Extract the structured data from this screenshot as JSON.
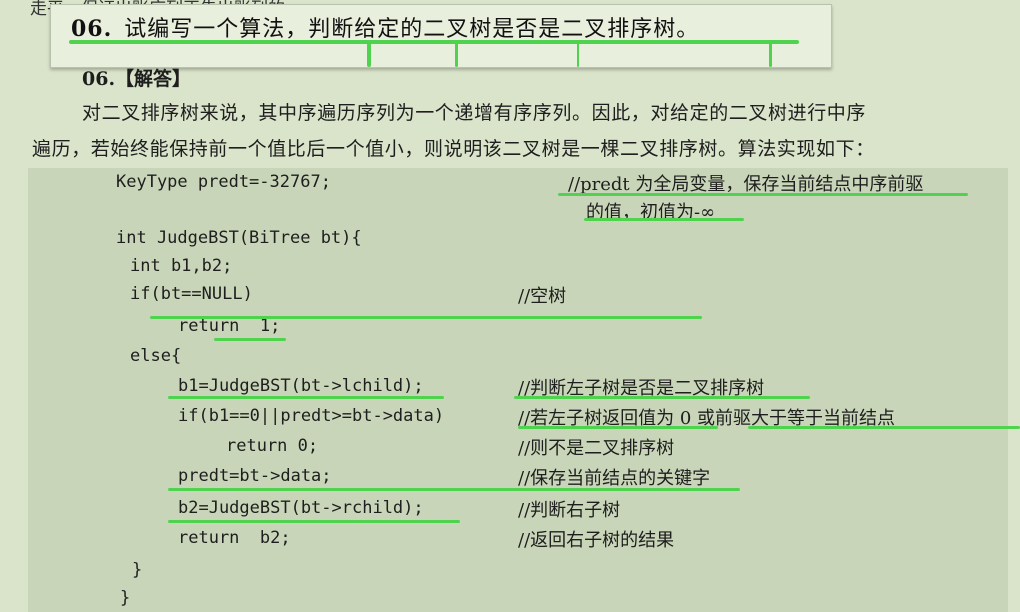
{
  "stray_text": "走平，保证出账序列正告出账列的",
  "question": {
    "number": "06.",
    "text": "试编写一个算法，判断给定的二叉树是否是二叉排序树。"
  },
  "answer": {
    "heading": "06.【解答】",
    "line1": "对二叉排序树来说，其中序遍历序列为一个递增有序序列。因此，对给定的二叉树进行中序",
    "line2": "遍历，若始终能保持前一个值比后一个值小，则说明该二叉树是一棵二叉排序树。算法实现如下："
  },
  "code_lines": [
    "KeyType predt=-32767;",
    "int JudgeBST(BiTree bt){",
    "int b1,b2;",
    "if(bt==NULL)",
    "return  1;",
    "else{",
    "b1=JudgeBST(bt->lchild);",
    "if(b1==0||predt>=bt->data)",
    "return 0;",
    "predt=bt->data;",
    "b2=JudgeBST(bt->rchild);",
    "return  b2;",
    "}",
    "}"
  ],
  "comments": [
    "//predt 为全局变量，保存当前结点中序前驱",
    "的值，初值为-∞",
    "//空树",
    "//判断左子树是否是二叉排序树",
    "//若左子树返回值为 0 或前驱大于等于当前结点",
    "//则不是二叉排序树",
    "//保存当前结点的关键字",
    "//判断右子树",
    "//返回右子树的结果"
  ],
  "highlight_color": "#4fd34f"
}
